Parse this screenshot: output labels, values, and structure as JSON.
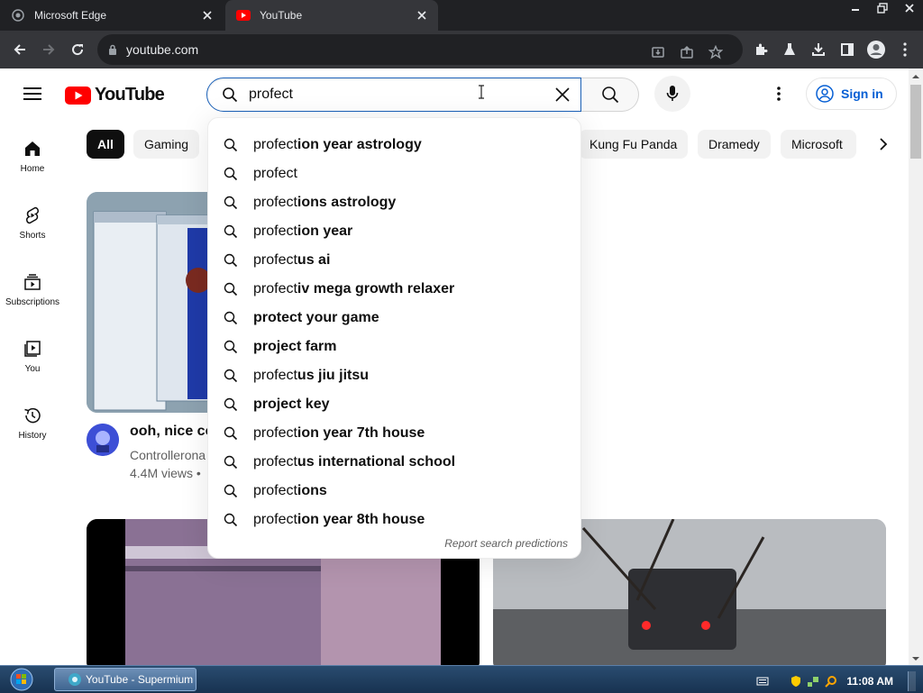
{
  "browser": {
    "tabs": [
      {
        "title": "Microsoft Edge",
        "active": false
      },
      {
        "title": "YouTube",
        "active": true
      }
    ],
    "address": "youtube.com"
  },
  "youtube": {
    "logo_text": "YouTube",
    "search": {
      "value": "profect",
      "suggestions": [
        {
          "typed": "profect",
          "rest": "ion year astrology"
        },
        {
          "typed": "profect",
          "rest": ""
        },
        {
          "typed": "profect",
          "rest": "ions astrology"
        },
        {
          "typed": "profect",
          "rest": "ion year"
        },
        {
          "typed": "profect",
          "rest": "us ai"
        },
        {
          "typed": "profect",
          "rest": "iv mega growth relaxer"
        },
        {
          "typed": "",
          "rest": "protect your game"
        },
        {
          "typed": "",
          "rest": "project farm"
        },
        {
          "typed": "profect",
          "rest": "us jiu jitsu"
        },
        {
          "typed": "",
          "rest": "project key"
        },
        {
          "typed": "profect",
          "rest": "ion year 7th house"
        },
        {
          "typed": "profect",
          "rest": "us international school"
        },
        {
          "typed": "profect",
          "rest": "ions"
        },
        {
          "typed": "profect",
          "rest": "ion year 8th house"
        }
      ],
      "report_link": "Report search predictions"
    },
    "signin_label": "Sign in",
    "guide": [
      {
        "label": "Home",
        "icon": "home-icon"
      },
      {
        "label": "Shorts",
        "icon": "shorts-icon"
      },
      {
        "label": "Subscriptions",
        "icon": "subscriptions-icon"
      },
      {
        "label": "You",
        "icon": "you-icon"
      },
      {
        "label": "History",
        "icon": "history-icon"
      }
    ],
    "chips": [
      "All",
      "Gaming",
      "Kung Fu Panda",
      "Dramedy",
      "Microsoft"
    ],
    "video": {
      "title": "ooh, nice co",
      "channel": "Controllerona",
      "meta": "4.4M views • "
    }
  },
  "taskbar": {
    "window_label": "YouTube - Supermium",
    "clock": "11:08 AM"
  },
  "colors": {
    "yt_red": "#ff0000",
    "link_blue": "#065fd4",
    "search_focus": "#1c62b9"
  }
}
